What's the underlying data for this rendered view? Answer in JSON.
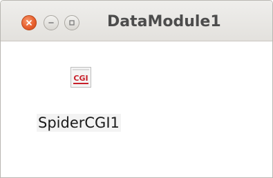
{
  "window": {
    "title": "DataModule1",
    "controls": {
      "close_icon": "close-icon",
      "minimize_icon": "minimize-icon",
      "maximize_icon": "maximize-icon"
    }
  },
  "components": [
    {
      "label": "SpiderCGI1",
      "icon_text": "CGI",
      "icon": "cgi-component-icon"
    }
  ],
  "colors": {
    "close_button": "#e8602f",
    "icon_red": "#c8202a",
    "title_text": "#4c4c4c"
  }
}
